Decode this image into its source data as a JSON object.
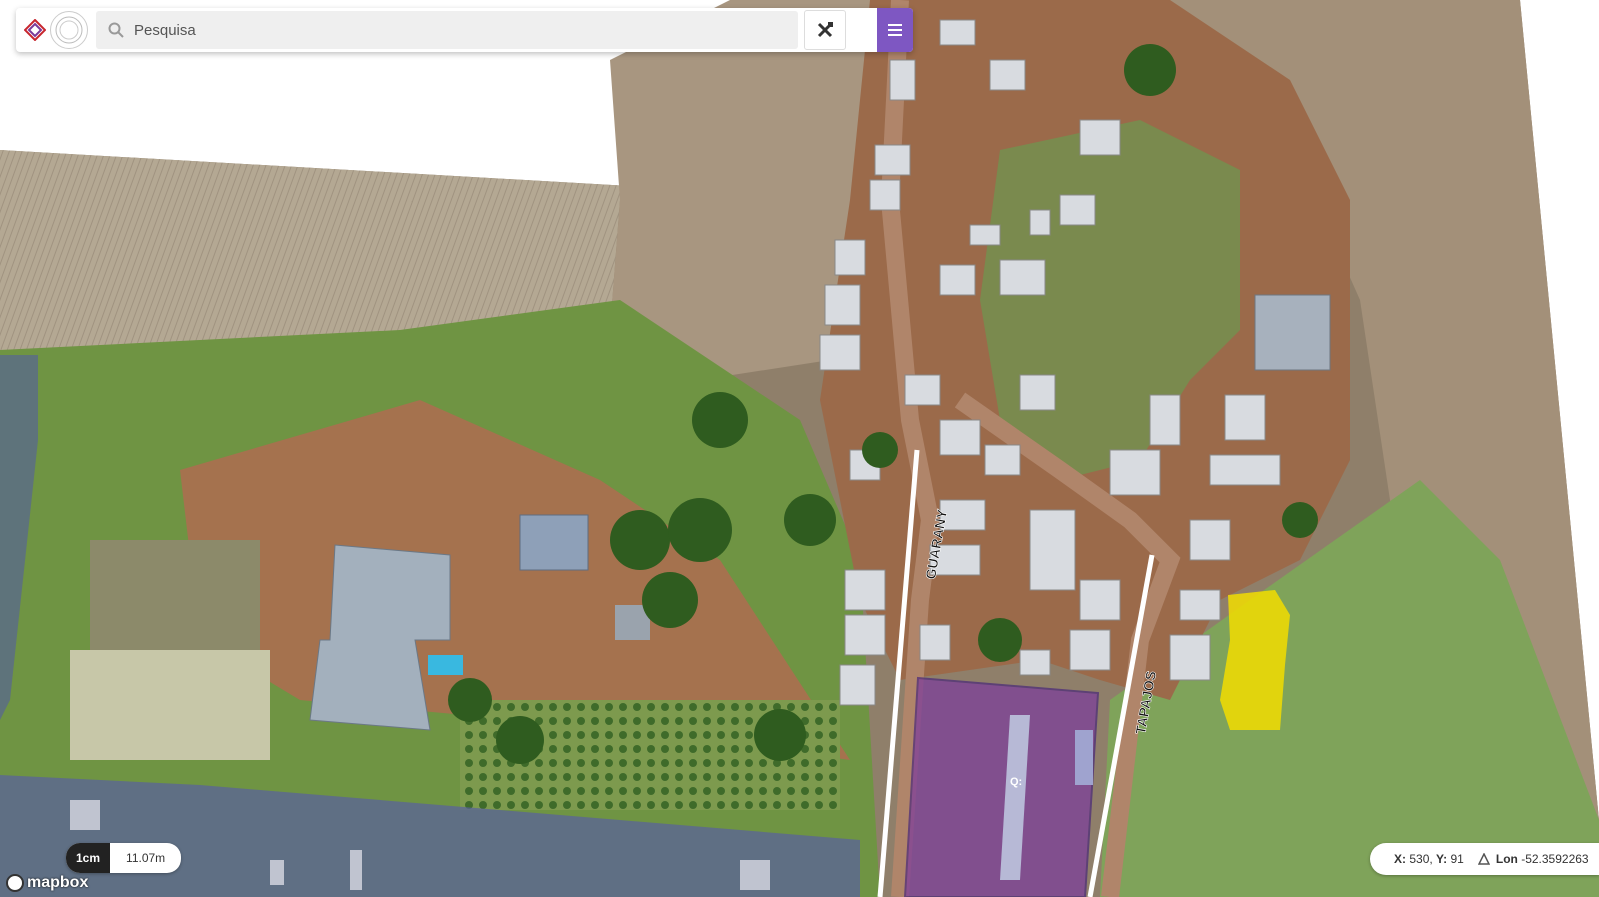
{
  "search": {
    "placeholder": "Pesquisa"
  },
  "icons": {
    "logo": "logo-icon",
    "seal": "seal-icon",
    "search": "search-icon",
    "tools": "ruler-pencil-icon",
    "menu": "hamburger-menu-icon",
    "north": "triangle-icon"
  },
  "colors": {
    "menu": "#7e57c2",
    "highlight": "#f2dd00",
    "parcel": "#6f2fa0"
  },
  "map": {
    "streets": [
      {
        "label": "GUARANY"
      },
      {
        "label": "TAPAJOS"
      }
    ],
    "parcel_label": "Q:"
  },
  "scale": {
    "unit": "1cm",
    "value": "11.07m"
  },
  "attribution": "mapbox",
  "coords": {
    "x_label": "X:",
    "x": "530,",
    "y_label": "Y:",
    "y": "91",
    "lon_label": "Lon",
    "lon": "-52.3592263"
  }
}
